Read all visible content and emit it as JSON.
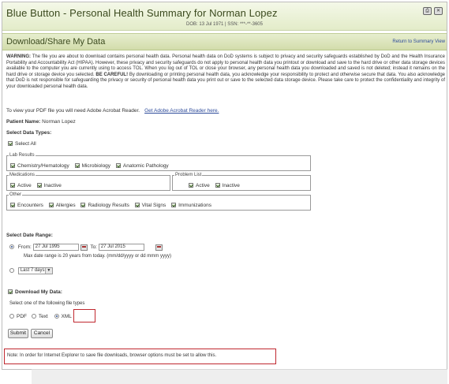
{
  "header": {
    "title": "Blue Button - Personal Health Summary for Norman Lopez",
    "dob_line": "DOB: 13 Jul 1971 | SSN: ***-**-3605"
  },
  "section": {
    "title": "Download/Share My Data",
    "return_link": "Return to Summary View"
  },
  "warning": {
    "label": "WARNING:",
    "text1": "The file you are about to download contains personal health data. Personal health data on DoD systems is subject to privacy and security safeguards established by DoD and the Health Insurance Portability and Accountability Act (HIPAA). However, these privacy and security safeguards do not apply to personal health data you printout or download and save to the hard drive or other data storage devices available to the computer you are currently using to access TOL. When you log out of TOL or close your browser, any personal health data you downloaded and saved is not deleted; instead it remains on the hard drive or storage device you selected.",
    "careful": "BE CAREFUL!",
    "text2": "By downloading or printing personal health data, you acknowledge your responsibility to protect and otherwise secure that data. You also acknowledge that DoD is not responsible for safeguarding the privacy or security of personal health data you print out or save to the selected data storage device. Please take care to protect the confidentiality and integrity of your downloaded personal health data."
  },
  "pdf_note": {
    "text": "To view your PDF file you will need Adobe Acrobat Reader.",
    "link": "Get Adobe Acrobat Reader here."
  },
  "patient": {
    "label": "Patient Name:",
    "value": "Norman Lopez"
  },
  "data_types": {
    "heading": "Select Data Types:",
    "select_all": "Select All",
    "lab": {
      "legend": "Lab Results",
      "items": [
        "Chemistry/Hematology",
        "Microbiology",
        "Anatomic Pathology"
      ]
    },
    "meds": {
      "legend": "Medications",
      "items": [
        "Active",
        "Inactive"
      ]
    },
    "problems": {
      "legend": "Problem List",
      "items": [
        "Active",
        "Inactive"
      ]
    },
    "other": {
      "legend": "Other",
      "items": [
        "Encounters",
        "Allergies",
        "Radiology Results",
        "Vital Signs",
        "Immunizations"
      ]
    }
  },
  "date_range": {
    "heading": "Select Date Range:",
    "from_label": "From:",
    "from_value": "27 Jul 1995",
    "to_label": "To:",
    "to_value": "27 Jul 2015",
    "hint": "Max date range is 20 years from today. (mm/dd/yyyy or dd mmm yyyy)",
    "preset_value": "Last 7 days"
  },
  "download": {
    "checkbox_label": "Download My Data:",
    "file_types_label": "Select one of the following file types",
    "options": [
      "PDF",
      "Text",
      "XML"
    ],
    "selected": "XML"
  },
  "buttons": {
    "submit": "Submit",
    "cancel": "Cancel"
  },
  "note": "Note: In order for Internet Explorer to save file downloads, browser options must be set to allow this.",
  "colors": {
    "header_green": "#e3ecc9",
    "highlight_red": "#c0282f",
    "link_blue": "#2c4a9a"
  }
}
